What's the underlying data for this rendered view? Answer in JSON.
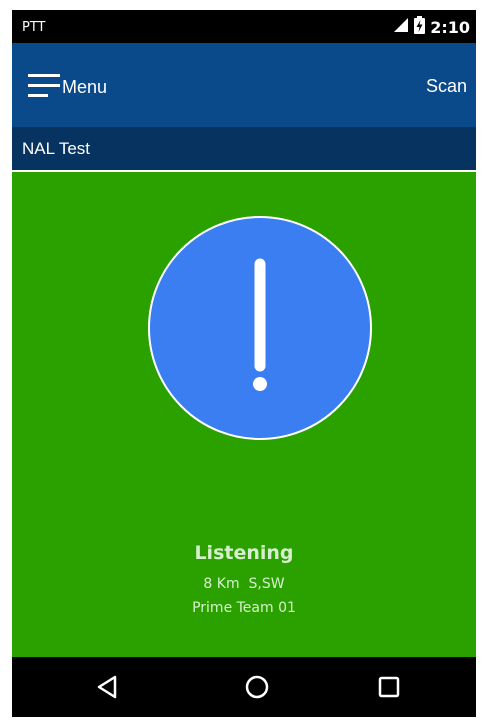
{
  "status_bar": {
    "app_label": "PTT",
    "time": "2:10",
    "icons": [
      "signal-icon",
      "battery-charging-icon"
    ]
  },
  "app_bar": {
    "menu_label": "Menu",
    "scan_label": "Scan",
    "background": "#0b4a8a"
  },
  "sub_bar": {
    "title": "NAL Test",
    "background": "#06335f"
  },
  "main": {
    "background": "#2ba100",
    "alert_icon": "exclamation-icon",
    "alert_circle_color": "#3a7ef2",
    "status": "Listening",
    "distance": "8 Km  S,SW",
    "team": "Prime Team 01"
  },
  "nav_bar": {
    "buttons": [
      "back-icon",
      "home-icon",
      "recents-icon"
    ]
  }
}
